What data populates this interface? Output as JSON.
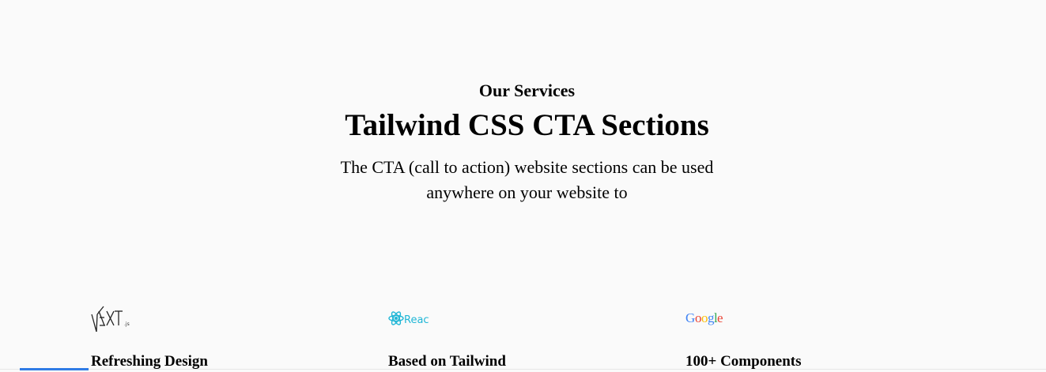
{
  "hero": {
    "eyebrow": "Our Services",
    "title": "Tailwind CSS CTA Sections",
    "description": "The CTA (call to action) website sections can be used anywhere on your website to"
  },
  "features": [
    {
      "logo_icon": "nextjs-logo-icon",
      "logo_text": "NEXT",
      "title": "Refreshing Design"
    },
    {
      "logo_icon": "react-logo-icon",
      "logo_text": "React",
      "title": "Based on Tailwind"
    },
    {
      "logo_icon": "google-logo-icon",
      "logo_text": "Google",
      "title": "100+ Components"
    }
  ],
  "colors": {
    "background": "#fafafa",
    "react": "#1fb6d6",
    "google_blue": "#4285f4",
    "google_red": "#ea4335",
    "google_yellow": "#fbbc05",
    "google_green": "#34a853",
    "accent": "#2f7be5"
  }
}
